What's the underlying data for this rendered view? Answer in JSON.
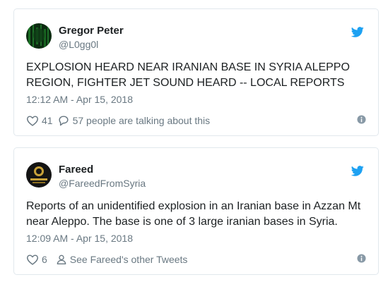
{
  "tweets": [
    {
      "name": "Gregor Peter",
      "handle": "@L0gg0l",
      "text": "EXPLOSION HEARD NEAR IRANIAN BASE IN SYRIA ALEPPO REGION, FIGHTER JET SOUND HEARD -- LOCAL REPORTS",
      "time": "12:12 AM - Apr 15, 2018",
      "like_count": "41",
      "second_action": "57 people are talking about this",
      "second_action_icon": "reply-bubble-icon"
    },
    {
      "name": "Fareed",
      "handle": "@FareedFromSyria",
      "text": "Reports of an unidentified explosion in an Iranian base in Azzan Mt near Aleppo. The base is one of 3 large iranian bases in Syria.",
      "time": "12:09 AM - Apr 15, 2018",
      "like_count": "6",
      "second_action": "See Fareed's other Tweets",
      "second_action_icon": "person-icon"
    }
  ],
  "colors": {
    "twitter_blue": "#1da1f2",
    "text": "#1c2022",
    "muted": "#697882",
    "border": "#e1e8ed"
  }
}
